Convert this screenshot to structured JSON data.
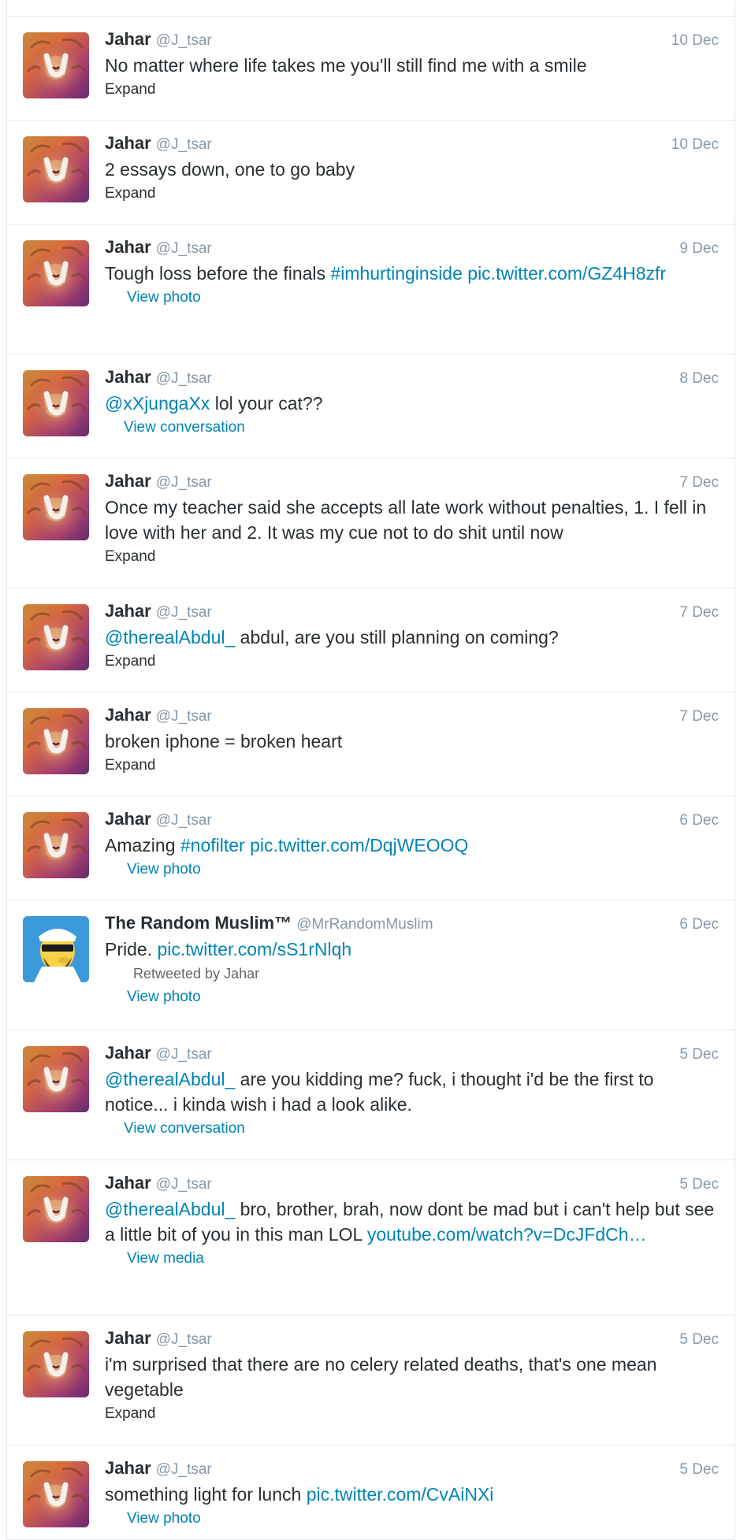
{
  "tweets": [
    {
      "name": "Jahar",
      "handle": "@J_tsar",
      "date": "10 Dec",
      "segments": [
        {
          "t": "No matter where life takes me you'll still find me with a smile",
          "link": false
        }
      ],
      "action": "Expand",
      "avatar": "lion",
      "height": 132
    },
    {
      "name": "Jahar",
      "handle": "@J_tsar",
      "date": "10 Dec",
      "segments": [
        {
          "t": "2 essays down, one to go baby",
          "link": false
        }
      ],
      "action": "Expand",
      "avatar": "lion",
      "height": 132
    },
    {
      "name": "Jahar",
      "handle": "@J_tsar",
      "date": "9 Dec",
      "segments": [
        {
          "t": "Tough loss before the finals ",
          "link": false
        },
        {
          "t": "#imhurtinginside",
          "link": true
        },
        {
          "t": " ",
          "link": false
        },
        {
          "t": "pic.twitter.com/GZ4H8zfr",
          "link": true
        }
      ],
      "action": "View photo",
      "action_style": "blue",
      "avatar": "lion",
      "height": 165
    },
    {
      "name": "Jahar",
      "handle": "@J_tsar",
      "date": "8 Dec",
      "segments": [
        {
          "t": "@xXjungaXx",
          "link": true
        },
        {
          "t": " lol your cat??",
          "link": false
        }
      ],
      "action": "View conversation",
      "action_style": "conv",
      "avatar": "lion",
      "height": 132
    },
    {
      "name": "Jahar",
      "handle": "@J_tsar",
      "date": "7 Dec",
      "segments": [
        {
          "t": "Once my teacher said she accepts all late work without penalties, 1. I fell in love with her and 2. It was my cue not to do shit until now",
          "link": false
        }
      ],
      "action": "Expand",
      "avatar": "lion",
      "height": 165
    },
    {
      "name": "Jahar",
      "handle": "@J_tsar",
      "date": "7 Dec",
      "segments": [
        {
          "t": "@therealAbdul_",
          "link": true
        },
        {
          "t": " abdul, are you still planning on coming?",
          "link": false
        }
      ],
      "action": "Expand",
      "avatar": "lion",
      "height": 132
    },
    {
      "name": "Jahar",
      "handle": "@J_tsar",
      "date": "7 Dec",
      "segments": [
        {
          "t": "broken iphone = broken heart",
          "link": false
        }
      ],
      "action": "Expand",
      "avatar": "lion",
      "height": 132
    },
    {
      "name": "Jahar",
      "handle": "@J_tsar",
      "date": "6 Dec",
      "segments": [
        {
          "t": "Amazing ",
          "link": false
        },
        {
          "t": "#nofilter",
          "link": true
        },
        {
          "t": " ",
          "link": false
        },
        {
          "t": "pic.twitter.com/DqjWEOOQ",
          "link": true
        }
      ],
      "action": "View photo",
      "action_style": "blue",
      "avatar": "lion",
      "height": 132
    },
    {
      "name": "The Random Muslim™",
      "handle": "@MrRandomMuslim",
      "date": "6 Dec",
      "segments": [
        {
          "t": "Pride. ",
          "link": false
        },
        {
          "t": "pic.twitter.com/sS1rNlqh",
          "link": true
        }
      ],
      "retweeted": "Retweeted by Jahar",
      "action": "View photo",
      "action_style": "blue",
      "avatar": "muslim",
      "height": 165
    },
    {
      "name": "Jahar",
      "handle": "@J_tsar",
      "date": "5 Dec",
      "segments": [
        {
          "t": "@therealAbdul_",
          "link": true
        },
        {
          "t": " are you kidding me? fuck, i thought i'd be the first to notice... i kinda wish i had a look alike.",
          "link": false
        }
      ],
      "action": "View conversation",
      "action_style": "conv",
      "avatar": "lion",
      "height": 165
    },
    {
      "name": "Jahar",
      "handle": "@J_tsar",
      "date": "5 Dec",
      "segments": [
        {
          "t": "@therealAbdul_",
          "link": true
        },
        {
          "t": " bro, brother, brah, now dont be mad but i can't help but see a little bit of you in this man LOL ",
          "link": false
        },
        {
          "t": "youtube.com/watch?v=DcJFdCh…",
          "link": true
        }
      ],
      "action": "View media",
      "action_style": "blue",
      "avatar": "lion",
      "height": 197
    },
    {
      "name": "Jahar",
      "handle": "@J_tsar",
      "date": "5 Dec",
      "segments": [
        {
          "t": "i'm surprised that there are no celery related deaths, that's one mean vegetable",
          "link": false
        }
      ],
      "action": "Expand",
      "avatar": "lion",
      "height": 165
    },
    {
      "name": "Jahar",
      "handle": "@J_tsar",
      "date": "5 Dec",
      "segments": [
        {
          "t": "something light for lunch ",
          "link": false
        },
        {
          "t": "pic.twitter.com/CvAiNXi",
          "link": true
        }
      ],
      "action": "View photo",
      "action_style": "blue",
      "avatar": "lion",
      "height": 120
    }
  ]
}
